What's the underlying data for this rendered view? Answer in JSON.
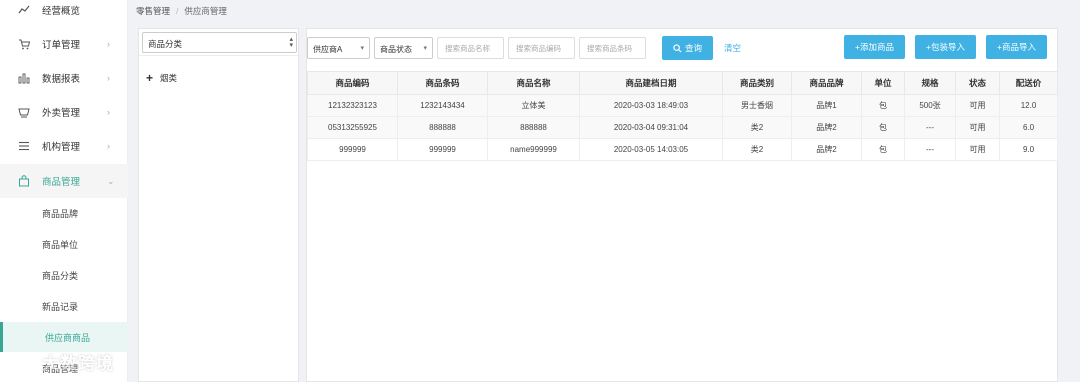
{
  "sidebar": {
    "menu": [
      {
        "label": "经营概览",
        "icon": "trend-icon",
        "arrow": ""
      },
      {
        "label": "订单管理",
        "icon": "cart-icon",
        "arrow": "›"
      },
      {
        "label": "数据报表",
        "icon": "bar-chart-icon",
        "arrow": "›"
      },
      {
        "label": "外卖管理",
        "icon": "basket-icon",
        "arrow": "›"
      },
      {
        "label": "机构管理",
        "icon": "list-icon",
        "arrow": "›"
      },
      {
        "label": "商品管理",
        "icon": "bag-icon",
        "arrow": "⌄"
      }
    ],
    "submenu": [
      {
        "label": "商品品牌"
      },
      {
        "label": "商品单位"
      },
      {
        "label": "商品分类"
      },
      {
        "label": "新品记录"
      },
      {
        "label": "供应商商品"
      },
      {
        "label": "商品管理"
      }
    ]
  },
  "breadcrumb": {
    "root": "零售管理",
    "sep": "/",
    "current": "供应商管理"
  },
  "category": {
    "select_value": "商品分类",
    "tree": [
      {
        "label": "烟类",
        "expand": "+"
      }
    ]
  },
  "filters": {
    "supplier": "供应商A",
    "status": "商品状态",
    "name_placeholder": "搜索商品名称",
    "code_placeholder": "搜索商品编码",
    "barcode_placeholder": "搜索商品条码",
    "query_label": "查询",
    "clear_label": "清空"
  },
  "actions": {
    "add_product": "+添加商品",
    "pack_import": "+包装导入",
    "product_import": "+商品导入"
  },
  "accent_color": "#3fb1e3",
  "brand_color": "#3aa796",
  "table": {
    "columns": [
      "商品编码",
      "商品条码",
      "商品名称",
      "商品建档日期",
      "商品类别",
      "商品品牌",
      "单位",
      "规格",
      "状态",
      "配送价"
    ],
    "rows": [
      [
        "12132323123",
        "1232143434",
        "立体美",
        "2020-03-03 18:49:03",
        "男士香烟",
        "品牌1",
        "包",
        "500张",
        "可用",
        "12.0"
      ],
      [
        "05313255925",
        "888888",
        "888888",
        "2020-03-04 09:31:04",
        "类2",
        "品牌2",
        "包",
        "---",
        "可用",
        "6.0"
      ],
      [
        "999999",
        "999999",
        "name999999",
        "2020-03-05 14:03:05",
        "类2",
        "品牌2",
        "包",
        "---",
        "可用",
        "9.0"
      ]
    ]
  },
  "watermark": {
    "text": "大数跨境"
  }
}
